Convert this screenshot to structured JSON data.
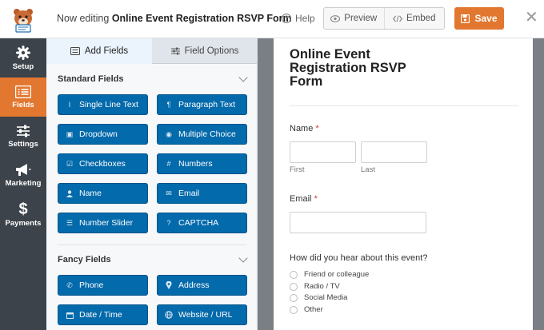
{
  "header": {
    "editing_prefix": "Now editing",
    "form_name": "Online Event Registration RSVP Form",
    "help_label": "Help",
    "preview_label": "Preview",
    "embed_label": "Embed",
    "save_label": "Save",
    "close_glyph": "✕",
    "save_color": "#e27730"
  },
  "sidenav": {
    "items": [
      {
        "label": "Setup",
        "icon": "gear-icon"
      },
      {
        "label": "Fields",
        "icon": "fields-list-icon",
        "active": true
      },
      {
        "label": "Settings",
        "icon": "sliders-icon"
      },
      {
        "label": "Marketing",
        "icon": "megaphone-icon"
      },
      {
        "label": "Payments",
        "icon": "dollar-icon"
      }
    ]
  },
  "panel": {
    "tabs": [
      {
        "label": "Add Fields",
        "icon": "list-icon",
        "active": true
      },
      {
        "label": "Field Options",
        "icon": "sliders-icon",
        "active": false
      }
    ],
    "standard_title": "Standard Fields",
    "standard_fields": [
      {
        "label": "Single Line Text",
        "icon": "text-icon"
      },
      {
        "label": "Paragraph Text",
        "icon": "paragraph-icon"
      },
      {
        "label": "Dropdown",
        "icon": "dropdown-icon"
      },
      {
        "label": "Multiple Choice",
        "icon": "radio-icon"
      },
      {
        "label": "Checkboxes",
        "icon": "checkbox-icon"
      },
      {
        "label": "Numbers",
        "icon": "hash-icon"
      },
      {
        "label": "Name",
        "icon": "user-icon"
      },
      {
        "label": "Email",
        "icon": "envelope-icon"
      },
      {
        "label": "Number Slider",
        "icon": "slider-icon"
      },
      {
        "label": "CAPTCHA",
        "icon": "question-icon"
      }
    ],
    "fancy_title": "Fancy Fields",
    "fancy_fields": [
      {
        "label": "Phone",
        "icon": "phone-icon"
      },
      {
        "label": "Address",
        "icon": "map-pin-icon"
      },
      {
        "label": "Date / Time",
        "icon": "calendar-icon"
      },
      {
        "label": "Website / URL",
        "icon": "link-icon"
      }
    ]
  },
  "form": {
    "title": "Online Event Registration RSVP Form",
    "name_label": "Name",
    "first_label": "First",
    "last_label": "Last",
    "email_label": "Email",
    "required_mark": "*",
    "source_question": "How did you hear about this event?",
    "source_options": [
      "Friend or colleague",
      "Radio / TV",
      "Social Media",
      "Other"
    ]
  }
}
